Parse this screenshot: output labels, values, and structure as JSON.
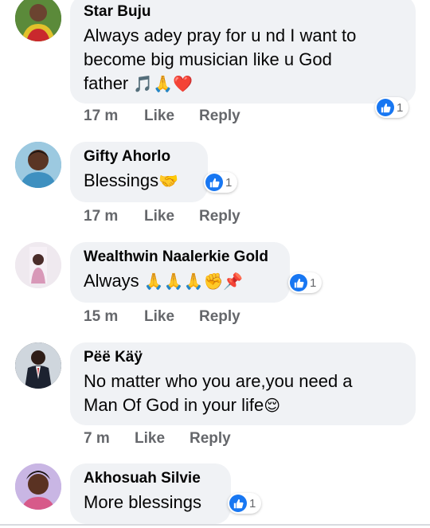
{
  "comments": [
    {
      "name": "Star Buju",
      "text": "Always adey pray for u nd I want to\nbecome big musician like u God\nfather",
      "emoji": "🎵🙏❤️",
      "reaction_count": "1",
      "time": "17 m",
      "like_label": "Like",
      "reply_label": "Reply",
      "colors": {
        "avatar_bg": "#3a6b2e"
      }
    },
    {
      "name": "Gifty Ahorlo",
      "text": "Blessings",
      "emoji": "🤝",
      "reaction_count": "1",
      "time": "17 m",
      "like_label": "Like",
      "reply_label": "Reply",
      "colors": {
        "avatar_bg": "#5aa0c8"
      }
    },
    {
      "name": "Wealthwin Naalerkie Gold",
      "text": "Always",
      "emoji": "🙏🙏🙏✊📌",
      "reaction_count": "1",
      "time": "15 m",
      "like_label": "Like",
      "reply_label": "Reply",
      "colors": {
        "avatar_bg": "#e9e4ea"
      }
    },
    {
      "name": "Pëë Käÿ",
      "text": "No matter who you are,you need a\nMan Of God in your life",
      "emoji": "😌",
      "time": "7 m",
      "like_label": "Like",
      "reply_label": "Reply",
      "colors": {
        "avatar_bg": "#20252d"
      }
    },
    {
      "name": "Akhosuah Silvie",
      "text": "More blessings",
      "reaction_count": "1",
      "colors": {
        "avatar_bg": "#b9a6d6"
      }
    }
  ],
  "colors": {
    "bubble": "#f0f2f5",
    "like_blue": "#1877f2",
    "meta_gray": "#65676b"
  },
  "icons": {
    "reaction": "like-thumb-icon"
  }
}
